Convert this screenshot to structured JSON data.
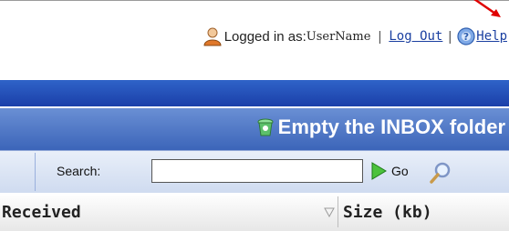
{
  "header": {
    "logged_in_prefix": "Logged in as:",
    "username": "UserName",
    "separator": "|",
    "logout_label": "Log Out",
    "help_label": "Help"
  },
  "toolbar": {
    "empty_inbox_label": "Empty the INBOX folder"
  },
  "search": {
    "label": "Search:",
    "value": "",
    "go_label": "Go"
  },
  "table": {
    "columns": [
      "Received",
      "Size (kb)"
    ]
  },
  "icons": {
    "user": "user-icon",
    "help": "help-icon",
    "trash": "trash-icon",
    "go": "go-arrow-icon",
    "search": "magnifier-icon",
    "sort": "sort-descending-icon",
    "annotation": "red-arrow-icon"
  },
  "colors": {
    "link": "#1a3fa0",
    "band": "#1a3ea8",
    "action_bar": "#3a63b8",
    "annotation_arrow": "#e00000"
  }
}
